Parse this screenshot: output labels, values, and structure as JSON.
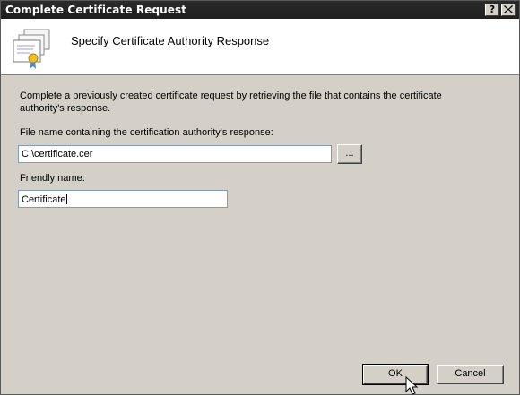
{
  "window": {
    "title": "Complete Certificate Request",
    "help_glyph": "?",
    "close_glyph": "X"
  },
  "header": {
    "title": "Specify Certificate Authority Response",
    "icon": "certificate-icon"
  },
  "content": {
    "description": "Complete a previously created certificate request by retrieving the file that contains the certificate authority's response.",
    "file_label": "File name containing the certification authority's response:",
    "file_value": "C:\\certificate.cer",
    "browse_label": "...",
    "friendly_label": "Friendly name:",
    "friendly_value": "Certificate"
  },
  "buttons": {
    "ok": "OK",
    "cancel": "Cancel"
  }
}
